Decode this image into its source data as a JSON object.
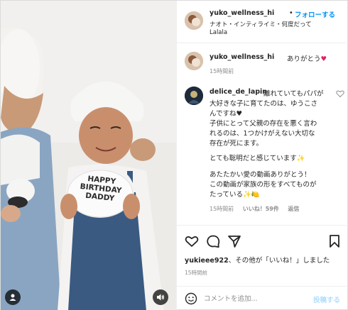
{
  "post": {
    "username": "yuko_wellness_hi",
    "separator": "•",
    "follow_label": "フォローする",
    "audio_line": "ナオト・インティライミ・何度だって",
    "audio_sub": "Lalala"
  },
  "media": {
    "cake_text": [
      "HAPPY",
      "BIRTHDAY",
      "DADDY"
    ]
  },
  "comments": [
    {
      "username": "yuko_wellness_hi",
      "text": "ありがとう",
      "emoji": "♥",
      "time": "15時間前"
    },
    {
      "username": "delice_de_lapin",
      "lines": [
        "離れていてもパパが",
        "大好きな子に育てたのは、ゆうこさ",
        "んですね♥",
        "子供にとって父親の存在を悪く言わ",
        "れるのは、1つかけがえない大切な",
        "存在が死にます。",
        "",
        "とても聡明だと感じています✨",
        "",
        "あたたかい愛の動画ありがとう！",
        "この動画が家族の形をすべてものが",
        "たっている✨🍋"
      ],
      "time": "15時間前",
      "likes": "いいね！59件",
      "reply": "返信"
    }
  ],
  "likes_line": {
    "user": "yukieee922",
    "rest": "、その他が「いいね！」しました"
  },
  "post_time": "15時間前",
  "composer": {
    "placeholder": "コメントを追加...",
    "post_label": "投稿する"
  },
  "colors": {
    "accent": "#0095f6",
    "post_disabled": "#b2dffc",
    "heart": "#e0245e",
    "muted": "#8e8e8e"
  },
  "icons": {
    "like": "heart-outline-icon",
    "comment": "comment-bubble-icon",
    "share": "paper-plane-icon",
    "save": "bookmark-icon",
    "emoji": "smiley-icon",
    "media_user": "user-tag-icon",
    "media_sound": "speaker-icon"
  }
}
